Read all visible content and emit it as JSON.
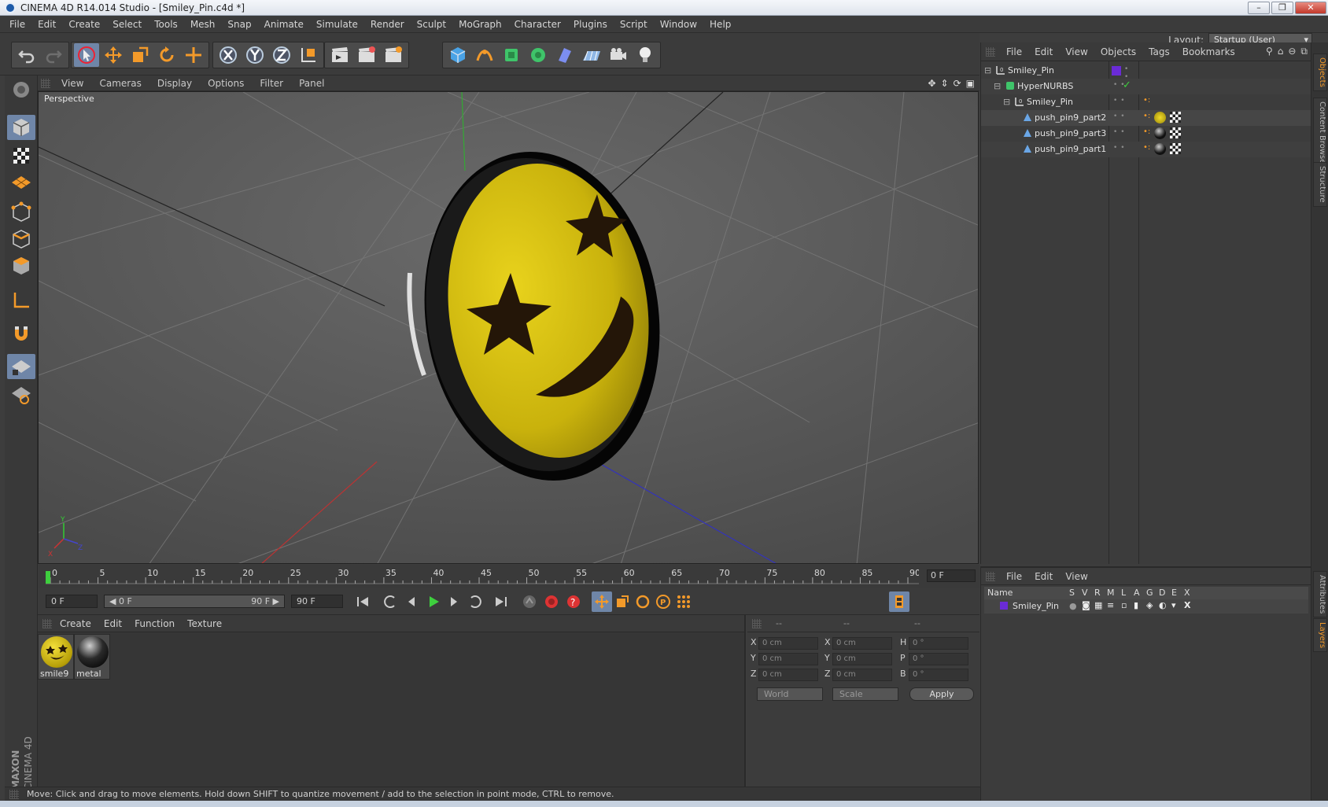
{
  "window": {
    "title": "CINEMA 4D R14.014 Studio - [Smiley_Pin.c4d *]",
    "controls": [
      "–",
      "❐",
      "✕"
    ]
  },
  "menubar": [
    "File",
    "Edit",
    "Create",
    "Select",
    "Tools",
    "Mesh",
    "Snap",
    "Animate",
    "Simulate",
    "Render",
    "Sculpt",
    "MoGraph",
    "Character",
    "Plugins",
    "Script",
    "Window",
    "Help"
  ],
  "layout": {
    "label": "Layout:",
    "value": "Startup (User)"
  },
  "viewport": {
    "menu": [
      "View",
      "Cameras",
      "Display",
      "Options",
      "Filter",
      "Panel"
    ],
    "label": "Perspective",
    "axes": {
      "y": "Y",
      "x": "X",
      "z": "Z"
    }
  },
  "timeline": {
    "ticks": [
      "0",
      "5",
      "10",
      "15",
      "20",
      "25",
      "30",
      "35",
      "40",
      "45",
      "50",
      "55",
      "60",
      "65",
      "70",
      "75",
      "80",
      "85",
      "90"
    ],
    "current_frame": "0 F"
  },
  "playback": {
    "start": "0 F",
    "range_start": "◀ 0 F",
    "range_end": "90 F ▶",
    "end": "90 F"
  },
  "materials": {
    "menu": [
      "Create",
      "Edit",
      "Function",
      "Texture"
    ],
    "items": [
      {
        "name": "smile9",
        "color": "#d9c21a"
      },
      {
        "name": "metal",
        "color": "#333333"
      }
    ]
  },
  "coordinates": {
    "headers": [
      "--",
      "--",
      "--"
    ],
    "rows": [
      {
        "l1": "X",
        "v1": "0 cm",
        "l2": "X",
        "v2": "0 cm",
        "l3": "H",
        "v3": "0 °"
      },
      {
        "l1": "Y",
        "v1": "0 cm",
        "l2": "Y",
        "v2": "0 cm",
        "l3": "P",
        "v3": "0 °"
      },
      {
        "l1": "Z",
        "v1": "0 cm",
        "l2": "Z",
        "v2": "0 cm",
        "l3": "B",
        "v3": "0 °"
      }
    ],
    "space": "World",
    "mode": "Scale",
    "apply": "Apply"
  },
  "objects": {
    "menu": [
      "File",
      "Edit",
      "View",
      "Objects",
      "Tags",
      "Bookmarks"
    ],
    "rows": [
      {
        "name": "Smiley_Pin",
        "indent": 0,
        "icon": "null-icon"
      },
      {
        "name": "HyperNURBS",
        "indent": 1,
        "icon": "hypernurbs-icon"
      },
      {
        "name": "Smiley_Pin",
        "indent": 2,
        "icon": "null-icon"
      },
      {
        "name": "push_pin9_part2",
        "indent": 3,
        "icon": "polygon-icon"
      },
      {
        "name": "push_pin9_part3",
        "indent": 3,
        "icon": "polygon-icon"
      },
      {
        "name": "push_pin9_part1",
        "indent": 3,
        "icon": "polygon-icon"
      }
    ]
  },
  "layers": {
    "menu": [
      "File",
      "Edit",
      "View"
    ],
    "columns": [
      "Name",
      "S",
      "V",
      "R",
      "M",
      "L",
      "A",
      "G",
      "D",
      "E",
      "X"
    ],
    "rows": [
      {
        "name": "Smiley_Pin",
        "color": "#6a2bd6"
      }
    ]
  },
  "side_tabs": [
    "Objects",
    "Content Browser",
    "Structure",
    "Attributes",
    "Layers"
  ],
  "status": "Move: Click and drag to move elements. Hold down SHIFT to quantize movement / add to the selection in point mode, CTRL to remove.",
  "brand": {
    "maker": "MAXON",
    "product": "CINEMA 4D"
  },
  "colors": {
    "accent": "#f39a2a",
    "selected": "#6f86a8",
    "smiley": "#d6bd12"
  }
}
